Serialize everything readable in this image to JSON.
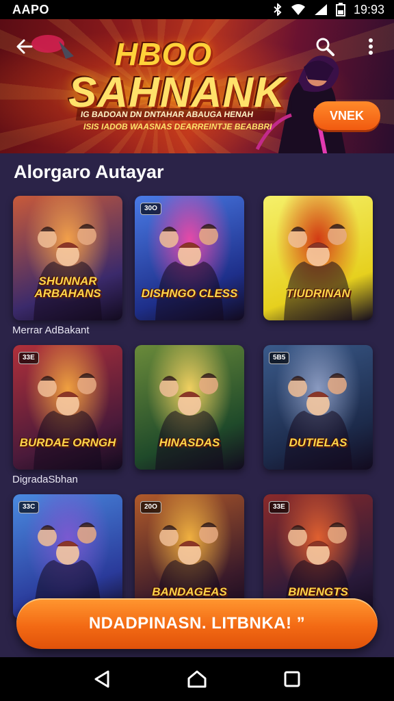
{
  "status_bar": {
    "carrier": "AAPO",
    "time": "19:93"
  },
  "hero": {
    "logo_top": "HBOO",
    "logo_main": "SAHNANK",
    "line1": "IG BADOAN DN  DNTAHAR ABAUGA HENAH",
    "line2": "ISIS IADOB WAASNAS DEARREINTJE BEABBRI",
    "cta_label": "VNEK",
    "accent": "#f15a10"
  },
  "section": {
    "title": "Alorgaro Autayar",
    "cards": [
      {
        "title": "SHUNNAR ARBAHANS",
        "badge": "",
        "palette": [
          "#3b2a6b",
          "#c85a3a",
          "#f3a04a"
        ]
      },
      {
        "title": "DISHNGO CLESS",
        "badge": "30O",
        "palette": [
          "#1e2f8a",
          "#4a7be6",
          "#e64aa8"
        ]
      },
      {
        "title": "TIUDRINAN",
        "badge": "",
        "palette": [
          "#e6d01e",
          "#f5f06a",
          "#d23a14"
        ]
      },
      {
        "title": "BURDAE ORNGH",
        "badge": "33E",
        "palette": [
          "#4a1a3a",
          "#b0303a",
          "#f0a040"
        ]
      },
      {
        "title": "HINASDAS",
        "badge": "",
        "palette": [
          "#1f4a2a",
          "#6a8a3a",
          "#f0d060"
        ]
      },
      {
        "title": "DUTIELAS",
        "badge": "5B5",
        "palette": [
          "#1c2a4a",
          "#3a5a8a",
          "#8a9ac0"
        ]
      },
      {
        "title": "",
        "badge": "33C",
        "palette": [
          "#2a3a9a",
          "#4a8ae0",
          "#7a5ad0"
        ]
      },
      {
        "title": "BANDAGEAS",
        "badge": "20O",
        "palette": [
          "#3a1a2a",
          "#b05a2a",
          "#f0b040"
        ]
      },
      {
        "title": "BINENGTS",
        "badge": "33E",
        "palette": [
          "#2a1a3a",
          "#8a2a2a",
          "#e06030"
        ]
      }
    ],
    "captions": [
      "Merrar AdBakant",
      "DigradaSbhan"
    ]
  },
  "float_cta": {
    "label": "NDADPINASN. LITBNKA! ”"
  },
  "nav": {
    "back": "back-icon",
    "home": "home-icon",
    "recents": "recents-icon"
  }
}
